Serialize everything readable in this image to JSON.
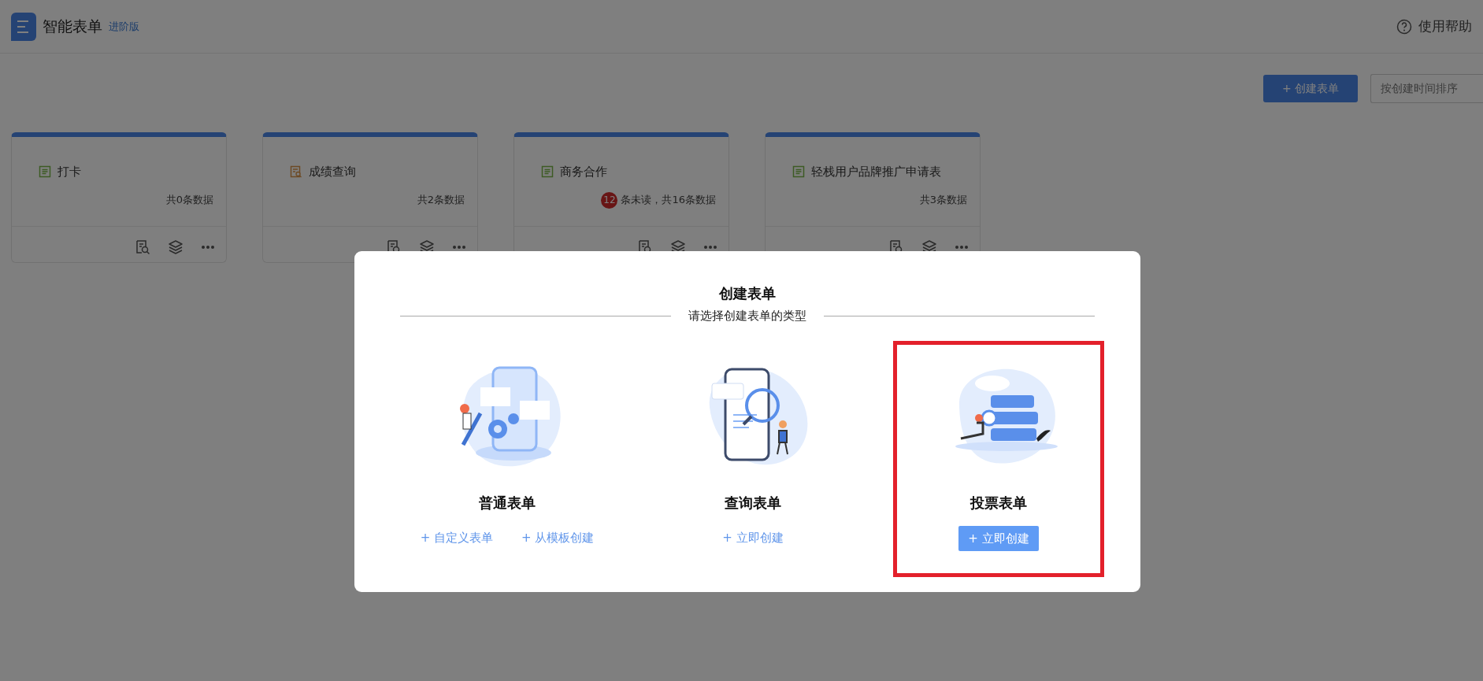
{
  "header": {
    "logo": "智能表单",
    "edition": "进阶版",
    "help": "使用帮助"
  },
  "toolbar": {
    "create_button": "+ 创建表单",
    "sort": "按创建时间排序"
  },
  "forms": [
    {
      "title": "打卡",
      "kind": "form",
      "count": "共0条数据"
    },
    {
      "title": "成绩查询",
      "kind": "query",
      "count": "共2条数据"
    },
    {
      "title": "商务合作",
      "kind": "form",
      "unread": "12",
      "count": "条未读，共16条数据"
    },
    {
      "title": "轻栈用户品牌推广申请表",
      "kind": "form",
      "count": "共3条数据"
    }
  ],
  "modal": {
    "title": "创建表单",
    "subtitle": "请选择创建表单的类型",
    "types": [
      {
        "name": "普通表单",
        "kind": "tools",
        "selected": false,
        "actions": [
          "+ 自定义表单",
          "+ 从模板创建"
        ]
      },
      {
        "name": "查询表单",
        "kind": "search",
        "selected": false,
        "actions": [
          "+ 立即创建"
        ]
      },
      {
        "name": "投票表单",
        "kind": "server",
        "selected": true,
        "actions": [
          "+ 立即创建"
        ]
      }
    ]
  }
}
